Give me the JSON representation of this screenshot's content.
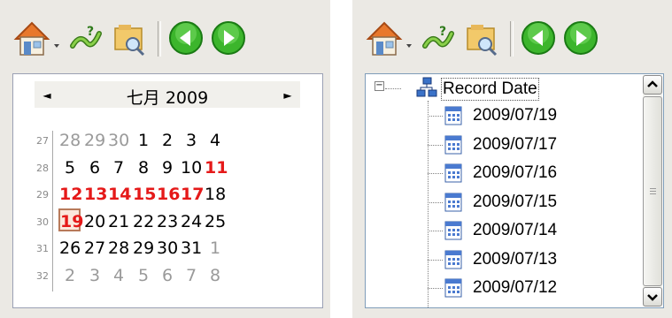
{
  "toolbar": {
    "icons": [
      "home-icon",
      "dropdown-arrow-icon",
      "link-icon",
      "search-folder-icon",
      "back-icon",
      "forward-icon"
    ],
    "accent_green": "#3cb52c",
    "home_color": "#e8782c"
  },
  "calendar": {
    "month_label": "七月 2009",
    "prev_arrow": "◄",
    "next_arrow": "►",
    "weeks": [
      {
        "num": "27",
        "days": [
          {
            "d": "28",
            "kind": "other"
          },
          {
            "d": "29",
            "kind": "other"
          },
          {
            "d": "30",
            "kind": "other"
          },
          {
            "d": "1",
            "kind": "normal"
          },
          {
            "d": "2",
            "kind": "normal"
          },
          {
            "d": "3",
            "kind": "normal"
          },
          {
            "d": "4",
            "kind": "normal"
          }
        ]
      },
      {
        "num": "28",
        "days": [
          {
            "d": "5",
            "kind": "normal"
          },
          {
            "d": "6",
            "kind": "normal"
          },
          {
            "d": "7",
            "kind": "normal"
          },
          {
            "d": "8",
            "kind": "normal"
          },
          {
            "d": "9",
            "kind": "normal"
          },
          {
            "d": "10",
            "kind": "normal"
          },
          {
            "d": "11",
            "kind": "holiday"
          }
        ]
      },
      {
        "num": "29",
        "days": [
          {
            "d": "12",
            "kind": "holiday"
          },
          {
            "d": "13",
            "kind": "holiday"
          },
          {
            "d": "14",
            "kind": "holiday"
          },
          {
            "d": "15",
            "kind": "holiday"
          },
          {
            "d": "16",
            "kind": "holiday"
          },
          {
            "d": "17",
            "kind": "holiday"
          },
          {
            "d": "18",
            "kind": "normal"
          }
        ]
      },
      {
        "num": "30",
        "days": [
          {
            "d": "19",
            "kind": "today"
          },
          {
            "d": "20",
            "kind": "normal"
          },
          {
            "d": "21",
            "kind": "normal"
          },
          {
            "d": "22",
            "kind": "normal"
          },
          {
            "d": "23",
            "kind": "normal"
          },
          {
            "d": "24",
            "kind": "normal"
          },
          {
            "d": "25",
            "kind": "normal"
          }
        ]
      },
      {
        "num": "31",
        "days": [
          {
            "d": "26",
            "kind": "normal"
          },
          {
            "d": "27",
            "kind": "normal"
          },
          {
            "d": "28",
            "kind": "normal"
          },
          {
            "d": "29",
            "kind": "normal"
          },
          {
            "d": "30",
            "kind": "normal"
          },
          {
            "d": "31",
            "kind": "normal"
          },
          {
            "d": "1",
            "kind": "other"
          }
        ]
      },
      {
        "num": "32",
        "days": [
          {
            "d": "2",
            "kind": "other"
          },
          {
            "d": "3",
            "kind": "other"
          },
          {
            "d": "4",
            "kind": "other"
          },
          {
            "d": "5",
            "kind": "other"
          },
          {
            "d": "6",
            "kind": "other"
          },
          {
            "d": "7",
            "kind": "other"
          },
          {
            "d": "8",
            "kind": "other"
          }
        ]
      }
    ]
  },
  "tree": {
    "root_toggle": "−",
    "root_label": "Record Date",
    "dates": [
      "2009/07/19",
      "2009/07/17",
      "2009/07/16",
      "2009/07/15",
      "2009/07/14",
      "2009/07/13",
      "2009/07/12"
    ]
  }
}
